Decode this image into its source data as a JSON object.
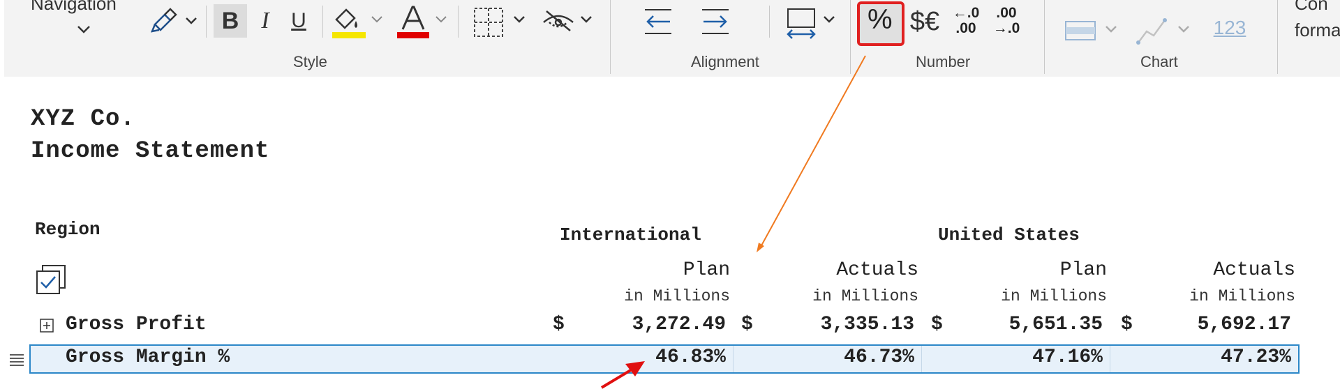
{
  "ribbon": {
    "navigation_label": "Navigation",
    "groups": {
      "style": "Style",
      "alignment": "Alignment",
      "number": "Number",
      "chart": "Chart"
    },
    "bold": "B",
    "italic": "I",
    "underline": "U",
    "percent": "%",
    "currency": "$€",
    "decrease_decimal_top": "←.0",
    "decrease_decimal_bottom": ".00",
    "increase_decimal_top": ".00",
    "increase_decimal_bottom": "→.0",
    "number_format": "123",
    "conditional_formatting_line1": "Con",
    "conditional_formatting_line2": "forma",
    "colors": {
      "highlight": "#f5e600",
      "font": "#e00000",
      "accent": "#1f5fa8",
      "highlight_box": "#e02020"
    }
  },
  "report": {
    "company": "XYZ Co.",
    "statement": "Income Statement",
    "region_label": "Region",
    "regions": [
      "International",
      "United States"
    ],
    "columns": [
      {
        "label": "Plan",
        "unit": "in Millions"
      },
      {
        "label": "Actuals",
        "unit": "in Millions"
      },
      {
        "label": "Plan",
        "unit": "in Millions"
      },
      {
        "label": "Actuals",
        "unit": "in Millions"
      }
    ],
    "rows": [
      {
        "label": "Gross Profit",
        "currency": "$",
        "values": [
          "3,272.49",
          "3,335.13",
          "5,651.35",
          "5,692.17"
        ]
      },
      {
        "label": "Gross Margin %",
        "values": [
          "46.83%",
          "46.73%",
          "47.16%",
          "47.23%"
        ]
      }
    ]
  }
}
